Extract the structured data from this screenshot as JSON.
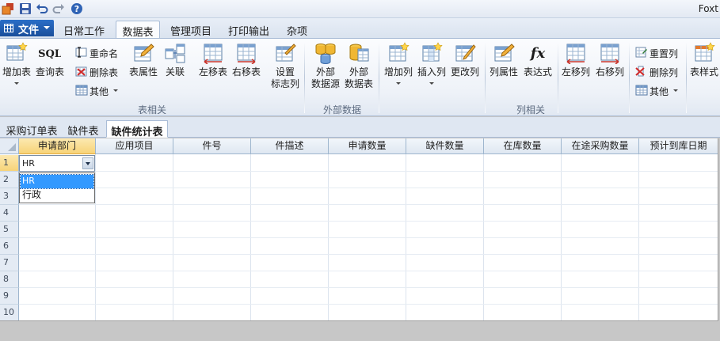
{
  "window": {
    "title": "Foxt"
  },
  "quick_access": [
    {
      "name": "app-icon"
    },
    {
      "name": "save-icon"
    },
    {
      "name": "undo-icon"
    },
    {
      "name": "redo-icon"
    },
    {
      "name": "help-icon"
    }
  ],
  "file_menu": {
    "label": "文件"
  },
  "ribbon_tabs": [
    {
      "label": "日常工作"
    },
    {
      "label": "数据表"
    },
    {
      "label": "管理项目"
    },
    {
      "label": "打印输出"
    },
    {
      "label": "杂项"
    }
  ],
  "ribbon": {
    "group_table": {
      "title": "表相关",
      "add_table": "增加表",
      "query_table": "查询表",
      "rename": "重命名",
      "delete_table": "删除表",
      "other": "其他",
      "table_props": "表属性",
      "relation": "关联",
      "move_left": "左移表",
      "move_right": "右移表",
      "set_flag": "设置",
      "set_flag2": "标志列",
      "sql_text": "SQL"
    },
    "group_external": {
      "title": "外部数据",
      "ext_source": "外部",
      "ext_source2": "数据源",
      "ext_table": "外部",
      "ext_table2": "数据表"
    },
    "group_column": {
      "title": "列相关",
      "add_col": "增加列",
      "insert_col": "插入列",
      "change_col": "更改列",
      "col_props": "列属性",
      "expression": "表达式",
      "move_left": "左移列",
      "move_right": "右移列",
      "reset_col": "重置列",
      "delete_col": "删除列",
      "other": "其他",
      "table_style": "表样式"
    }
  },
  "sheet_tabs": [
    {
      "label": "采购订单表"
    },
    {
      "label": "缺件表"
    },
    {
      "label": "缺件统计表"
    }
  ],
  "grid": {
    "columns": [
      "申请部门",
      "应用项目",
      "件号",
      "件描述",
      "申请数量",
      "缺件数量",
      "在库数量",
      "在途采购数量",
      "预计到库日期"
    ],
    "rows": [
      "1",
      "2",
      "3",
      "4",
      "5",
      "6",
      "7",
      "8",
      "9",
      "10"
    ],
    "editor_value": "HR",
    "dropdown_options": [
      "HR",
      "行政"
    ]
  }
}
